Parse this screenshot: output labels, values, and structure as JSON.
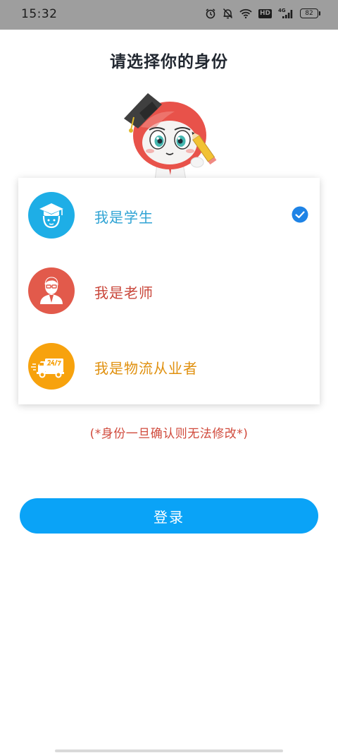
{
  "status_bar": {
    "time": "15:32",
    "network_badge": "HD",
    "signal_label": "4G",
    "battery_level": "82",
    "icons": [
      "alarm-icon",
      "mute-bell-icon",
      "wifi-icon",
      "hd-badge",
      "signal-icon",
      "battery-icon"
    ]
  },
  "page": {
    "title": "请选择你的身份"
  },
  "roles": [
    {
      "label": "我是学生",
      "color": "#2fa3d4",
      "avatar_bg": "#1eaee6",
      "icon": "graduate-icon",
      "selected": true
    },
    {
      "label": "我是老师",
      "color": "#c9463a",
      "avatar_bg": "#e25a4b",
      "icon": "teacher-icon",
      "selected": false
    },
    {
      "label": "我是物流从业者",
      "color": "#e0900e",
      "avatar_bg": "#f7a20d",
      "icon": "delivery-truck-icon",
      "selected": false
    }
  ],
  "notice": "(*身份一旦确认则无法修改*)",
  "login": {
    "label": "登录",
    "color": "#0aa3f7"
  }
}
